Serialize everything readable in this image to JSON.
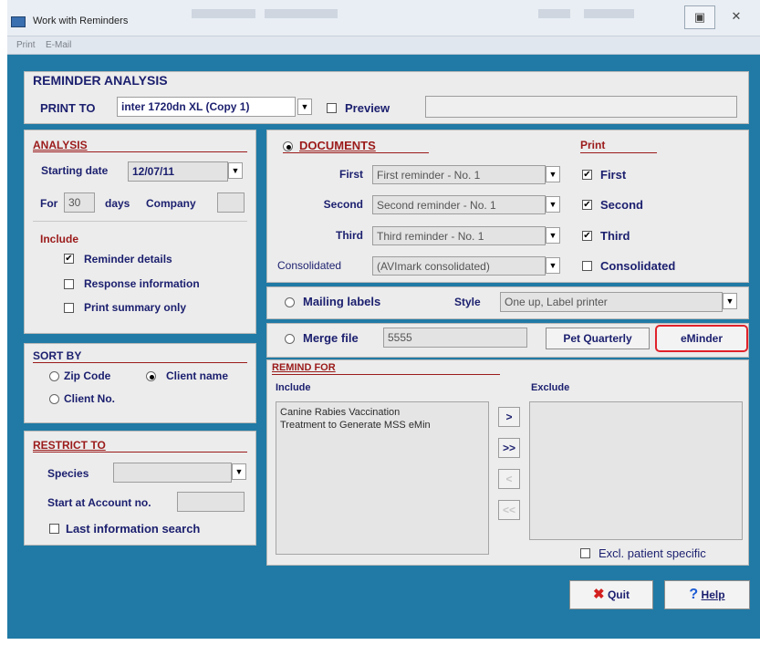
{
  "window": {
    "title": "Work with Reminders",
    "max_icon": "restore-icon",
    "close_icon": "close-icon"
  },
  "menu": [
    "Print",
    "E-Mail"
  ],
  "header": {
    "title": "REMINDER ANALYSIS",
    "print_to_label": "PRINT TO",
    "printer": "inter 1720dn XL (Copy 1)",
    "preview_label": "Preview",
    "preview_checked": false
  },
  "analysis": {
    "title": "ANALYSIS",
    "starting_date_label": "Starting date",
    "starting_date": "12/07/11",
    "for_label": "For",
    "days_value": "30",
    "days_label": "days",
    "company_label": "Company",
    "company_value": "",
    "include_label": "Include",
    "options": [
      {
        "label": "Reminder details",
        "checked": true
      },
      {
        "label": "Response information",
        "checked": false
      },
      {
        "label": "Print summary only",
        "checked": false
      }
    ]
  },
  "sort_by": {
    "title": "SORT BY",
    "options": [
      {
        "label": "Zip Code",
        "selected": false
      },
      {
        "label": "Client name",
        "selected": true
      },
      {
        "label": "Client No.",
        "selected": false
      }
    ]
  },
  "restrict_to": {
    "title": "RESTRICT TO",
    "species_label": "Species",
    "species_value": "",
    "start_account_label": "Start at Account no.",
    "start_account_value": "",
    "last_info_label": "Last information search",
    "last_info_checked": false
  },
  "documents": {
    "title": "DOCUMENTS",
    "selected": true,
    "print_header": "Print",
    "rows": [
      {
        "label": "First",
        "value": "First reminder - No. 1",
        "print_label": "First",
        "checked": true
      },
      {
        "label": "Second",
        "value": "Second reminder - No. 1",
        "print_label": "Second",
        "checked": true
      },
      {
        "label": "Third",
        "value": "Third reminder - No. 1",
        "print_label": "Third",
        "checked": true
      },
      {
        "label": "Consolidated",
        "value": "(AVImark consolidated)",
        "print_label": "Consolidated",
        "checked": false
      }
    ]
  },
  "mailing": {
    "label": "Mailing labels",
    "style_label": "Style",
    "style_value": "One up, Label printer"
  },
  "merge": {
    "label": "Merge file",
    "value": "5555",
    "pet_quarterly_label": "Pet Quarterly",
    "eminder_label": "eMinder"
  },
  "remind_for": {
    "title": "REMIND FOR",
    "include_label": "Include",
    "exclude_label": "Exclude",
    "include_items": [
      "Canine Rabies Vaccination",
      "Treatment to Generate MSS eMin"
    ],
    "exclude_items": [],
    "buttons": [
      ">",
      ">>",
      "<",
      "<<"
    ],
    "excl_patient_label": "Excl. patient specific",
    "excl_patient_checked": false
  },
  "footer": {
    "quit_label": "Quit",
    "help_label": "Help",
    "quit_icon": "x-icon",
    "help_icon": "question-icon"
  },
  "colors": {
    "frame": "#207aa5",
    "panel": "#ececec",
    "section_title": "#9b1a1a",
    "label": "#1b1f6e",
    "highlight": "#e0222a"
  }
}
